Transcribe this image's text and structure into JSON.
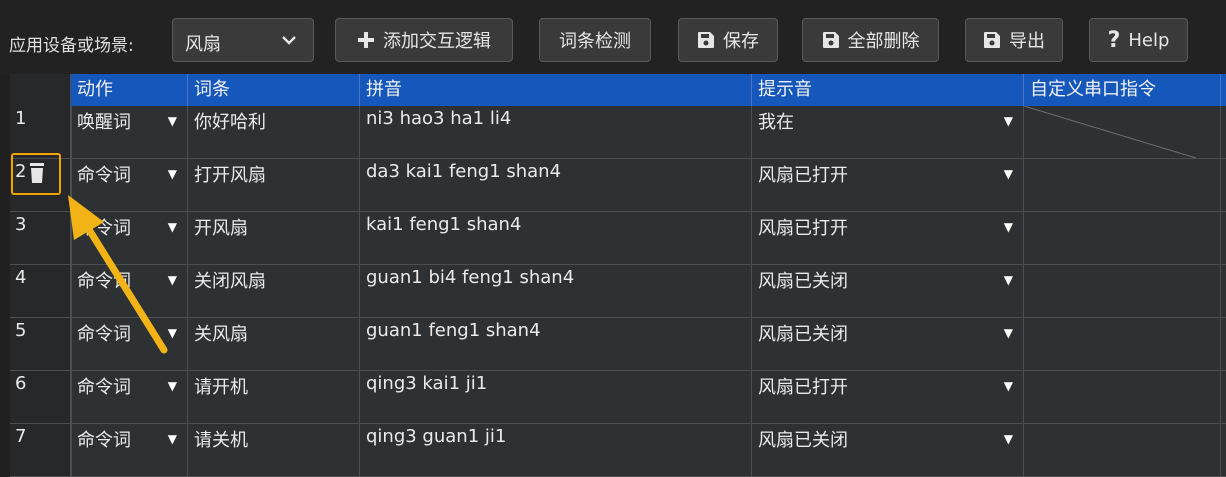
{
  "toolbar": {
    "device_label": "应用设备或场景:",
    "device_value": "风扇",
    "buttons": {
      "add_logic": "添加交互逻辑",
      "check_terms": "词条检测",
      "save": "保存",
      "delete_all": "全部删除",
      "export": "导出",
      "help": "Help"
    }
  },
  "table": {
    "headers": [
      "动作",
      "词条",
      "拼音",
      "提示音",
      "自定义串口指令"
    ],
    "rows": [
      {
        "num": "1",
        "action": "唤醒词",
        "term": "你好哈利",
        "pinyin": "ni3 hao3 ha1 li4",
        "prompt": "我在"
      },
      {
        "num": "2",
        "action": "命令词",
        "term": "打开风扇",
        "pinyin": "da3 kai1 feng1 shan4",
        "prompt": "风扇已打开"
      },
      {
        "num": "3",
        "action": "命令词",
        "term": "开风扇",
        "pinyin": "kai1 feng1 shan4",
        "prompt": "风扇已打开"
      },
      {
        "num": "4",
        "action": "命令词",
        "term": "关闭风扇",
        "pinyin": "guan1 bi4 feng1 shan4",
        "prompt": "风扇已关闭"
      },
      {
        "num": "5",
        "action": "命令词",
        "term": "关风扇",
        "pinyin": "guan1 feng1 shan4",
        "prompt": "风扇已关闭"
      },
      {
        "num": "6",
        "action": "命令词",
        "term": "请开机",
        "pinyin": "qing3 kai1 ji1",
        "prompt": "风扇已打开"
      },
      {
        "num": "7",
        "action": "命令词",
        "term": "请关机",
        "pinyin": "qing3 guan1 ji1",
        "prompt": "风扇已关闭"
      }
    ]
  },
  "colors": {
    "header_blue": "#1557bb",
    "highlight_orange": "#f0a400"
  },
  "icons": {
    "add": "plus-icon",
    "save": "floppy-icon",
    "delete_all": "floppy-icon",
    "export": "floppy-icon",
    "help": "question-icon",
    "row_delete": "trash-icon",
    "dropdown": "chevron-down-icon"
  }
}
